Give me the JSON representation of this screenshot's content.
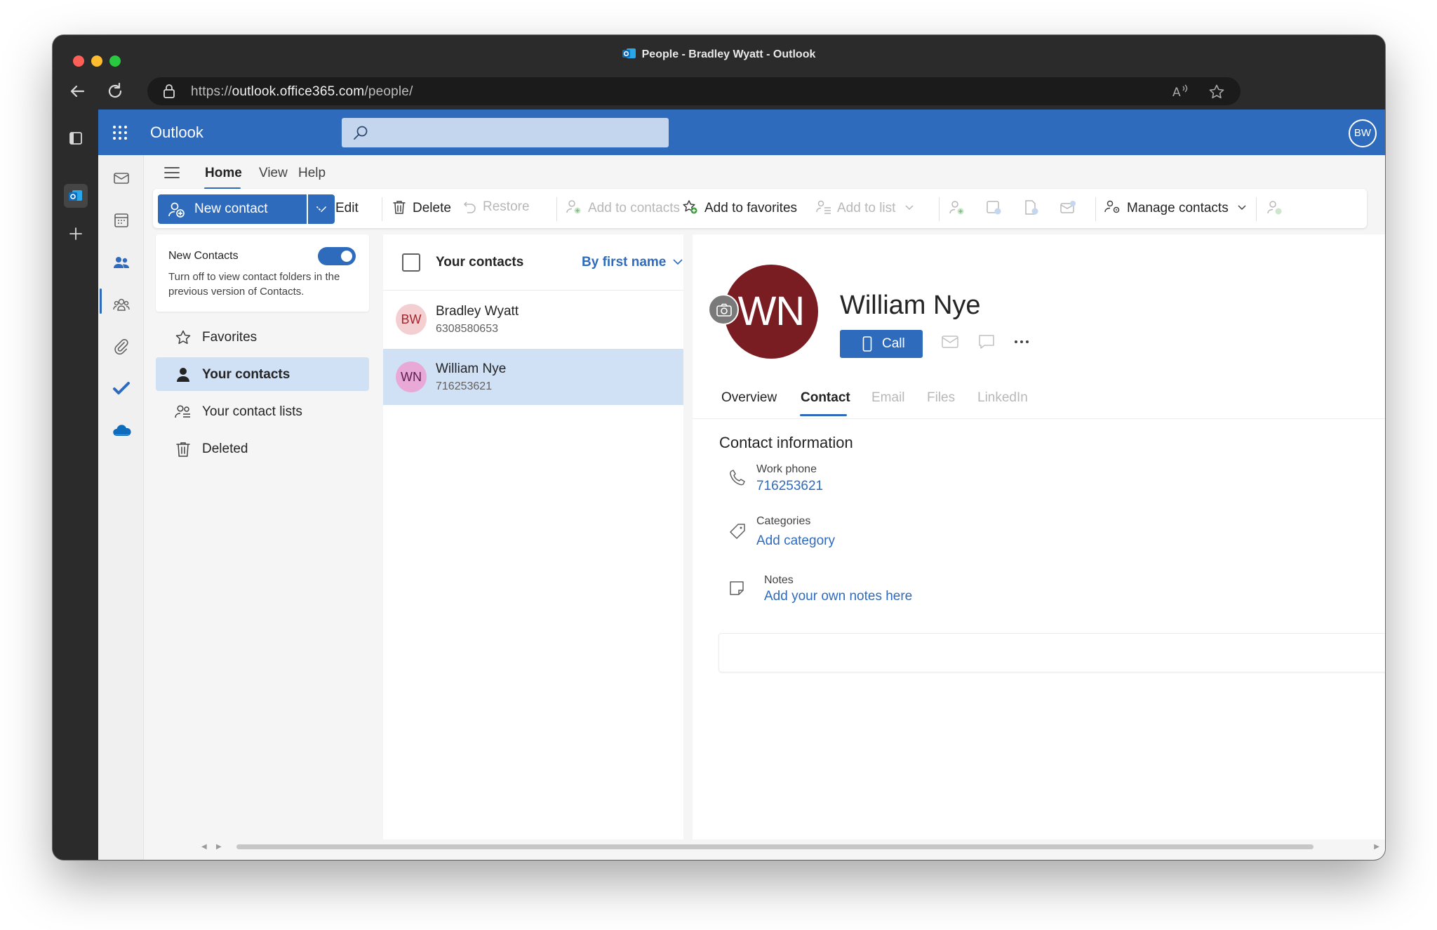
{
  "window": {
    "title": "People - Bradley Wyatt - Outlook"
  },
  "browser": {
    "url_prefix": "https://",
    "url_host": "outlook.office365.com",
    "url_path": "/people/"
  },
  "app": {
    "name": "Outlook",
    "user_initials": "BW",
    "search_placeholder": ""
  },
  "ribbon": {
    "tabs": [
      "Home",
      "View",
      "Help"
    ],
    "active_tab": "Home"
  },
  "commands": {
    "new_contact": "New contact",
    "edit": "Edit",
    "delete": "Delete",
    "restore": "Restore",
    "add_to_contacts": "Add to contacts",
    "add_to_favorites": "Add to favorites",
    "add_to_list": "Add to list",
    "manage_contacts": "Manage contacts"
  },
  "nav": {
    "new_contacts_title": "New Contacts",
    "new_contacts_desc": "Turn off to view contact folders in the previous version of Contacts.",
    "new_contacts_enabled": true,
    "items": [
      {
        "label": "Favorites",
        "icon": "star-icon",
        "selected": false
      },
      {
        "label": "Your contacts",
        "icon": "person-icon",
        "selected": true
      },
      {
        "label": "Your contact lists",
        "icon": "people-list-icon",
        "selected": false
      },
      {
        "label": "Deleted",
        "icon": "trash-icon",
        "selected": false
      }
    ]
  },
  "list": {
    "title": "Your contacts",
    "sort_label": "By first name",
    "contacts": [
      {
        "initials": "BW",
        "name": "Bradley Wyatt",
        "phone": "6308580653",
        "selected": false,
        "avatar_bg": "#f4cfd2",
        "avatar_fg": "#a4262c"
      },
      {
        "initials": "WN",
        "name": "William Nye",
        "phone": "716253621",
        "selected": true,
        "avatar_bg": "#e8a9d7",
        "avatar_fg": "#5c1e4f"
      }
    ]
  },
  "detail": {
    "initials": "WN",
    "name": "William Nye",
    "call_label": "Call",
    "avatar_color": "#7a1d22",
    "tabs": [
      {
        "label": "Overview",
        "state": "normal"
      },
      {
        "label": "Contact",
        "state": "active"
      },
      {
        "label": "Email",
        "state": "disabled"
      },
      {
        "label": "Files",
        "state": "disabled"
      },
      {
        "label": "LinkedIn",
        "state": "disabled"
      }
    ],
    "section_title": "Contact information",
    "work_phone_label": "Work phone",
    "work_phone": "716253621",
    "categories_label": "Categories",
    "add_category": "Add category",
    "notes_label": "Notes",
    "notes_placeholder": "Add your own notes here"
  },
  "colors": {
    "brand": "#2f6bbd",
    "selection": "#d0e0f5"
  }
}
